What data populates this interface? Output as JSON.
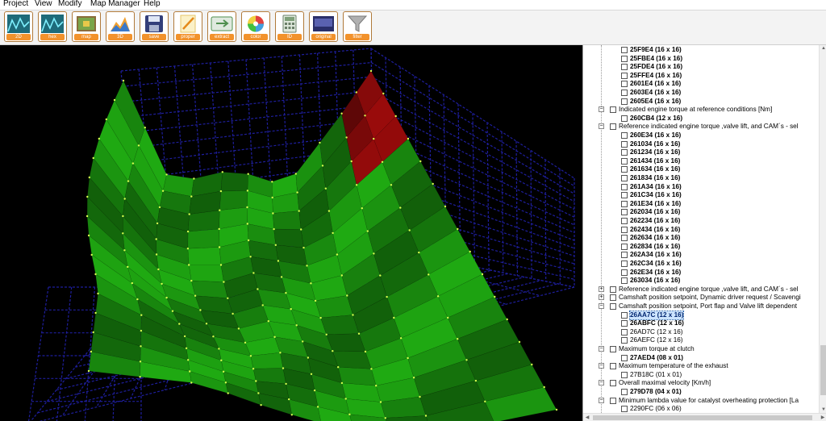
{
  "menu": [
    "Project",
    "View",
    "Modify",
    "Map Manager",
    "Help"
  ],
  "toolbar": [
    {
      "label": "2D",
      "icon": "2d-graph-icon",
      "color": "#1e6b7a"
    },
    {
      "label": "hex",
      "icon": "hex-graph-icon",
      "color": "#1e6b7a"
    },
    {
      "label": "map",
      "icon": "map-icon",
      "color": "#7aa54a"
    },
    {
      "label": "3D",
      "icon": "3d-chart-icon",
      "color": "#f0a030"
    },
    {
      "label": "save",
      "icon": "save-icon",
      "color": "#333f7a"
    },
    {
      "label": "proper",
      "icon": "properties-icon",
      "color": "#e5c56a"
    },
    {
      "label": "extract",
      "icon": "extract-icon",
      "color": "#4f8f4f"
    },
    {
      "label": "color",
      "icon": "color-wheel-icon",
      "color": "#d04040"
    },
    {
      "label": "ID",
      "icon": "calculator-icon",
      "color": "#90a890"
    },
    {
      "label": "original",
      "icon": "original-icon",
      "color": "#2a2f6a"
    },
    {
      "label": "filter",
      "icon": "filter-icon",
      "color": "#b0b0b0"
    }
  ],
  "tree": [
    {
      "level": 2,
      "type": "map",
      "label": "25F9E4 (16 x 16)"
    },
    {
      "level": 2,
      "type": "map",
      "label": "25FBE4 (16 x 16)"
    },
    {
      "level": 2,
      "type": "map",
      "label": "25FDE4 (16 x 16)"
    },
    {
      "level": 2,
      "type": "map",
      "label": "25FFE4 (16 x 16)"
    },
    {
      "level": 2,
      "type": "map",
      "label": "2601E4 (16 x 16)"
    },
    {
      "level": 2,
      "type": "map",
      "label": "2603E4 (16 x 16)"
    },
    {
      "level": 2,
      "type": "map",
      "label": "2605E4 (16 x 16)"
    },
    {
      "level": 1,
      "type": "group",
      "expand": "-",
      "label": "Indicated engine torque at reference conditions  [Nm]"
    },
    {
      "level": 2,
      "type": "map",
      "label": "260CB4 (12 x 16)"
    },
    {
      "level": 1,
      "type": "group",
      "expand": "-",
      "label": "Reference indicated engine torque ,valve lift, and CAM´s - sel"
    },
    {
      "level": 2,
      "type": "map",
      "label": "260E34 (16 x 16)"
    },
    {
      "level": 2,
      "type": "map",
      "label": "261034 (16 x 16)"
    },
    {
      "level": 2,
      "type": "map",
      "label": "261234 (16 x 16)"
    },
    {
      "level": 2,
      "type": "map",
      "label": "261434 (16 x 16)"
    },
    {
      "level": 2,
      "type": "map",
      "label": "261634 (16 x 16)"
    },
    {
      "level": 2,
      "type": "map",
      "label": "261834 (16 x 16)"
    },
    {
      "level": 2,
      "type": "map",
      "label": "261A34 (16 x 16)"
    },
    {
      "level": 2,
      "type": "map",
      "label": "261C34 (16 x 16)"
    },
    {
      "level": 2,
      "type": "map",
      "label": "261E34 (16 x 16)"
    },
    {
      "level": 2,
      "type": "map",
      "label": "262034 (16 x 16)"
    },
    {
      "level": 2,
      "type": "map",
      "label": "262234 (16 x 16)"
    },
    {
      "level": 2,
      "type": "map",
      "label": "262434 (16 x 16)"
    },
    {
      "level": 2,
      "type": "map",
      "label": "262634 (16 x 16)"
    },
    {
      "level": 2,
      "type": "map",
      "label": "262834 (16 x 16)"
    },
    {
      "level": 2,
      "type": "map",
      "label": "262A34 (16 x 16)"
    },
    {
      "level": 2,
      "type": "map",
      "label": "262C34 (16 x 16)"
    },
    {
      "level": 2,
      "type": "map",
      "label": "262E34 (16 x 16)"
    },
    {
      "level": 2,
      "type": "map",
      "label": "263034 (16 x 16)"
    },
    {
      "level": 1,
      "type": "group",
      "expand": "+",
      "label": "Reference indicated engine torque ,valve lift, and CAM´s - sel"
    },
    {
      "level": 1,
      "type": "group",
      "expand": "+",
      "label": "Camshaft position setpoint, Dynamic driver request / Scavengi"
    },
    {
      "level": 1,
      "type": "group",
      "expand": "-",
      "label": "Camshaft position setpoint, Port flap and Valve lift dependent"
    },
    {
      "level": 2,
      "type": "map",
      "selected": true,
      "label": "26AA7C (12 x 16)"
    },
    {
      "level": 2,
      "type": "map",
      "label": "26ABFC (12 x 16)"
    },
    {
      "level": 2,
      "type": "plain",
      "label": "26AD7C (12 x 16)"
    },
    {
      "level": 2,
      "type": "plain",
      "label": "26AEFC (12 x 16)"
    },
    {
      "level": 1,
      "type": "group",
      "expand": "-",
      "label": "Maximum torque at clutch"
    },
    {
      "level": 2,
      "type": "map",
      "label": "27AED4 (08 x 01)"
    },
    {
      "level": 1,
      "type": "group",
      "expand": "-",
      "label": "Maximum temperature of the exhaust"
    },
    {
      "level": 2,
      "type": "plain",
      "label": "27B18C (01 x 01)"
    },
    {
      "level": 1,
      "type": "group",
      "expand": "-",
      "label": "Overall maximal velocity [Km/h]"
    },
    {
      "level": 2,
      "type": "map",
      "label": "279D78 (04 x 01)"
    },
    {
      "level": 1,
      "type": "group",
      "expand": "-",
      "label": "Minimum lambda value for catalyst overheating protection [La"
    },
    {
      "level": 2,
      "type": "plain",
      "label": "2290FC (06 x 06)"
    }
  ],
  "chart_data": {
    "type": "surface",
    "rows": 12,
    "cols": 16,
    "surface_color": "#1faa12",
    "peak_color": "#9a0b0b",
    "grid_color": "#1e1e9c",
    "point_color": "#d8ff50"
  }
}
